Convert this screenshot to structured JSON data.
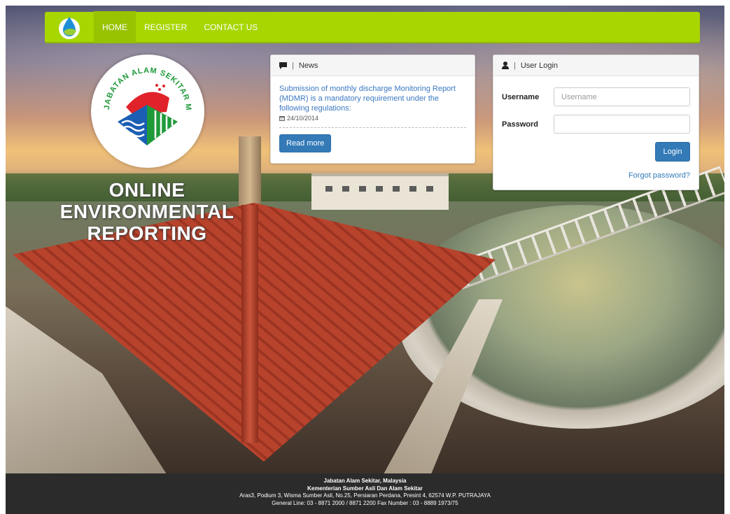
{
  "nav": {
    "items": [
      {
        "label": "HOME",
        "active": true
      },
      {
        "label": "REGISTER",
        "active": false
      },
      {
        "label": "CONTACT US",
        "active": false
      }
    ],
    "accent_color": "#a7d600",
    "brand_icon": "water-drop-leaf-icon"
  },
  "logo": {
    "arc_text": "JABATAN ALAM SEKITAR MALAYSIA"
  },
  "title_lines": [
    "ONLINE",
    "ENVIRONMENTAL",
    "REPORTING"
  ],
  "news": {
    "heading": "News",
    "icon": "comment-icon",
    "item": {
      "text": "Submission of monthly discharge Monitoring Report (MDMR) is a mandatory requirement under the following regulations:",
      "date": "24/10/2014"
    },
    "read_more": "Read more"
  },
  "login": {
    "heading": "User Login",
    "icon": "user-icon",
    "username_label": "Username",
    "username_placeholder": "Username",
    "password_label": "Password",
    "button": "Login",
    "forgot": "Forgot password?"
  },
  "footer": {
    "line1": "Jabatan Alam Sekitar, Malaysia",
    "line2": "Kementerian Sumber Asli Dan Alam Sekitar",
    "line3": "Aras3, Podium 3, Wisma Sumber Asli, No.25, Persiaran Perdana, Presint 4, 62574 W.P. PUTRAJAYA",
    "line4": "General Line: 03 - 8871 2000 / 8871 2200 Fax Number : 03 - 8889 1973/75"
  },
  "colors": {
    "primary": "#337ab7",
    "footer_bg": "#2b2b2b"
  }
}
